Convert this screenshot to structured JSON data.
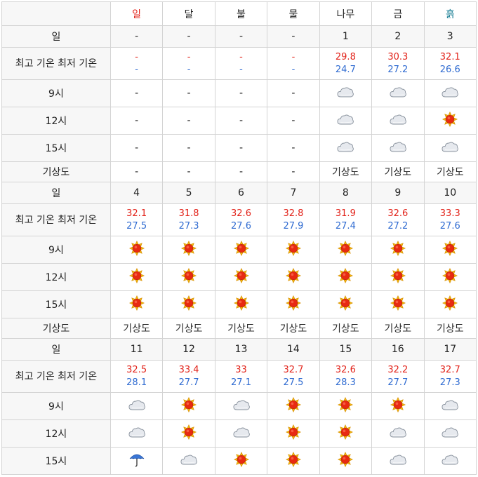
{
  "colors": {
    "sun": "#e2231a",
    "hi": "#e2231a",
    "lo": "#2f6bd1",
    "sat": "#1b7f95"
  },
  "header": {
    "days": [
      "일",
      "달",
      "불",
      "물",
      "나무",
      "금",
      "흙"
    ]
  },
  "labels": {
    "day": "일",
    "temp": "최고 기온 최저 기온",
    "h9": "9시",
    "h12": "12시",
    "h15": "15시",
    "map": "기상도"
  },
  "empty": "-",
  "weeks": [
    {
      "days": [
        "-",
        "-",
        "-",
        "-",
        "1",
        "2",
        "3"
      ],
      "hi": [
        "-",
        "-",
        "-",
        "-",
        "29.8",
        "30.3",
        "32.1"
      ],
      "lo": [
        "-",
        "-",
        "-",
        "-",
        "24.7",
        "27.2",
        "26.6"
      ],
      "h9": [
        "none",
        "none",
        "none",
        "none",
        "cloud-icon",
        "cloud-icon",
        "cloud-icon"
      ],
      "h12": [
        "none",
        "none",
        "none",
        "none",
        "cloud-icon",
        "cloud-icon",
        "sun-icon"
      ],
      "h15": [
        "none",
        "none",
        "none",
        "none",
        "cloud-icon",
        "cloud-icon",
        "cloud-icon"
      ],
      "map": [
        "-",
        "-",
        "-",
        "-",
        "기상도",
        "기상도",
        "기상도"
      ]
    },
    {
      "days": [
        "4",
        "5",
        "6",
        "7",
        "8",
        "9",
        "10"
      ],
      "hi": [
        "32.1",
        "31.8",
        "32.6",
        "32.8",
        "31.9",
        "32.6",
        "33.3"
      ],
      "lo": [
        "27.5",
        "27.3",
        "27.6",
        "27.9",
        "27.4",
        "27.2",
        "27.6"
      ],
      "h9": [
        "sun-icon",
        "sun-icon",
        "sun-icon",
        "sun-icon",
        "sun-icon",
        "sun-icon",
        "sun-icon"
      ],
      "h12": [
        "sun-icon",
        "sun-icon",
        "sun-icon",
        "sun-icon",
        "sun-icon",
        "sun-icon",
        "sun-icon"
      ],
      "h15": [
        "sun-icon",
        "sun-icon",
        "sun-icon",
        "sun-icon",
        "sun-icon",
        "sun-icon",
        "sun-icon"
      ],
      "map": [
        "기상도",
        "기상도",
        "기상도",
        "기상도",
        "기상도",
        "기상도",
        "기상도"
      ]
    },
    {
      "days": [
        "11",
        "12",
        "13",
        "14",
        "15",
        "16",
        "17"
      ],
      "hi": [
        "32.5",
        "33.4",
        "33",
        "32.7",
        "32.6",
        "32.2",
        "32.7"
      ],
      "lo": [
        "28.1",
        "27.7",
        "27.1",
        "27.5",
        "28.3",
        "27.7",
        "27.3"
      ],
      "h9": [
        "cloud-icon",
        "sun-icon",
        "cloud-icon",
        "sun-icon",
        "sun-icon",
        "sun-icon",
        "cloud-icon"
      ],
      "h12": [
        "cloud-icon",
        "sun-icon",
        "cloud-icon",
        "sun-icon",
        "sun-icon",
        "cloud-icon",
        "cloud-icon"
      ],
      "h15": [
        "umbrella-icon",
        "cloud-icon",
        "sun-icon",
        "sun-icon",
        "sun-icon",
        "cloud-icon",
        "cloud-icon"
      ]
    }
  ]
}
